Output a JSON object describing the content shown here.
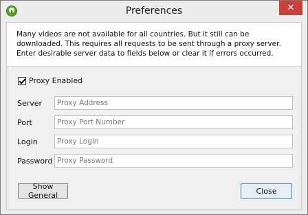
{
  "window": {
    "title": "Preferences",
    "close_glyph": "✕",
    "app_icon": "app-logo-icon"
  },
  "info": {
    "text": "Many videos are not available for all countries. But it still can be downloaded. This requires all requests to be sent through a proxy server. Enter desirable server data to fields below or clear it if errors occurred."
  },
  "proxy": {
    "enabled_label": "Proxy Enabled",
    "enabled": true
  },
  "fields": {
    "server": {
      "label": "Server",
      "placeholder": "Proxy Address",
      "value": ""
    },
    "port": {
      "label": "Port",
      "placeholder": "Proxy Port Number",
      "value": ""
    },
    "login": {
      "label": "Login",
      "placeholder": "Proxy Login",
      "value": ""
    },
    "password": {
      "label": "Password",
      "placeholder": "Proxy Password",
      "value": ""
    }
  },
  "buttons": {
    "show_general": "Show General",
    "close": "Close"
  },
  "colors": {
    "close_button": "#c7403a",
    "primary_border": "#3c7fb1"
  }
}
